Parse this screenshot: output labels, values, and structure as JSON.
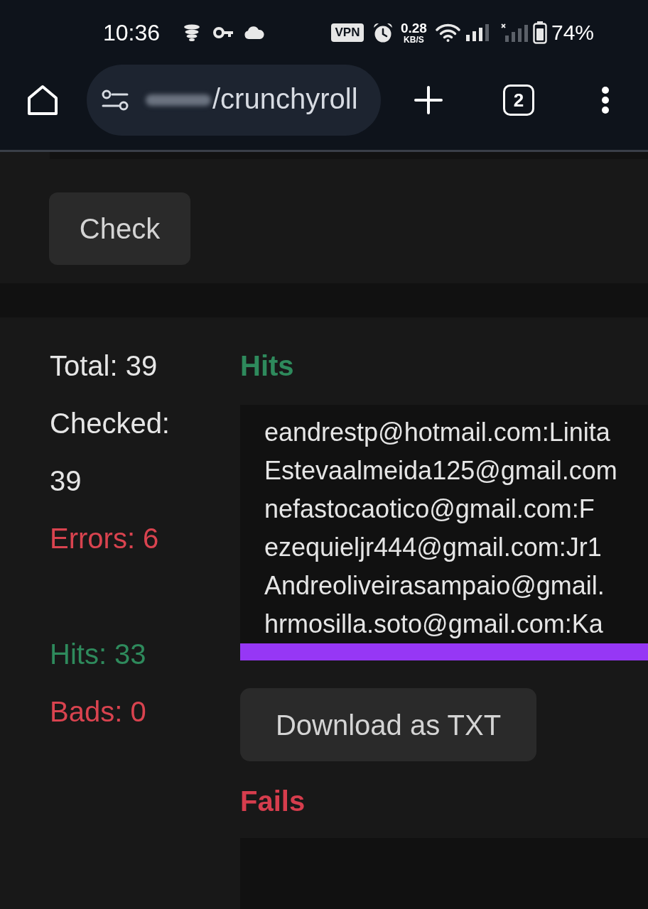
{
  "status_bar": {
    "time": "10:36",
    "vpn_badge": "VPN",
    "net_speed": "0.28",
    "net_speed_unit": "KB/S",
    "battery": "74%"
  },
  "browser_toolbar": {
    "url": "/crunchyroll",
    "tab_count": "2"
  },
  "check_button": "Check",
  "stat_groups": [
    {
      "items": [
        {
          "text": "Total: 39",
          "color": "#e6e6e6"
        },
        {
          "text": "Checked: 39",
          "color": "#e6e6e6"
        },
        {
          "text": "Errors: 6",
          "color": "#d9434f"
        }
      ]
    },
    {
      "items": [
        {
          "text": "Hits: 33",
          "color": "#2e8a5c"
        },
        {
          "text": "Bads: 0",
          "color": "#d9434f"
        }
      ]
    }
  ],
  "hits": {
    "title": "Hits",
    "lines": [
      "eandrestp@hotmail.com:Linita",
      "Estevaalmeida125@gmail.com",
      "nefastocaotico@gmail.com:F",
      "ezequieljr444@gmail.com:Jr1",
      "Andreoliveirasampaio@gmail.",
      "hrmosilla.soto@gmail.com:Ka"
    ],
    "download_button": "Download as TXT"
  },
  "fails": {
    "title": "Fails"
  }
}
